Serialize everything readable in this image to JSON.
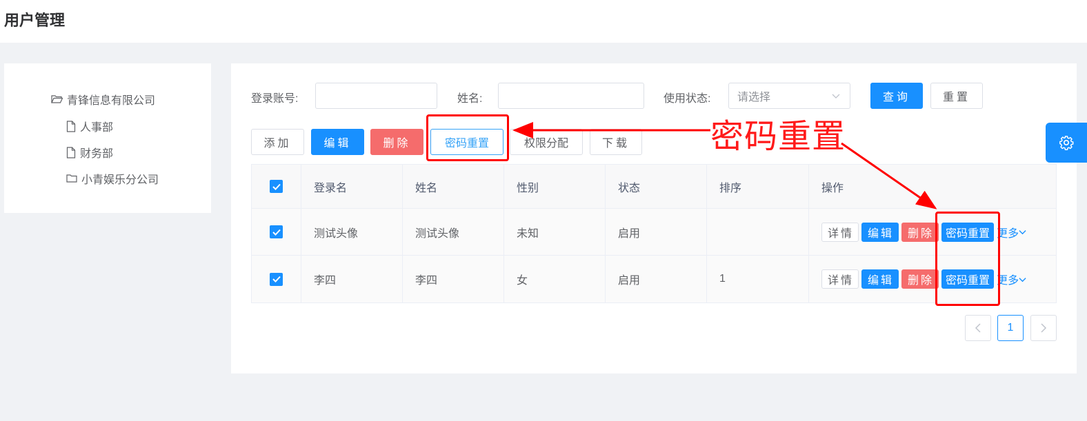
{
  "page": {
    "title": "用户管理"
  },
  "tree": {
    "root": "青锋信息有限公司",
    "children": [
      "人事部",
      "财务部",
      "小青娱乐分公司"
    ]
  },
  "search": {
    "account_label": "登录账号:",
    "account_value": "",
    "name_label": "姓名:",
    "name_value": "",
    "status_label": "使用状态:",
    "status_placeholder": "请选择",
    "query_label": "查询",
    "reset_label": "重置"
  },
  "toolbar": {
    "add": "添加",
    "edit": "编辑",
    "delete": "删除",
    "password_reset": "密码重置",
    "permission": "权限分配",
    "download": "下载"
  },
  "table": {
    "columns": [
      "登录名",
      "姓名",
      "性别",
      "状态",
      "排序",
      "操作"
    ],
    "rows": [
      {
        "checked": true,
        "login": "测试头像",
        "name": "测试头像",
        "gender": "未知",
        "status": "启用",
        "order": ""
      },
      {
        "checked": true,
        "login": "李四",
        "name": "李四",
        "gender": "女",
        "status": "启用",
        "order": "1"
      }
    ],
    "actions": {
      "detail": "详情",
      "edit": "编辑",
      "delete": "删除",
      "password_reset": "密码重置",
      "more": "更多"
    }
  },
  "pagination": {
    "current": "1"
  },
  "annotation": {
    "text": "密码重置",
    "color": "#ff0000"
  },
  "colors": {
    "primary": "#1890ff",
    "danger": "#f56c6c"
  }
}
